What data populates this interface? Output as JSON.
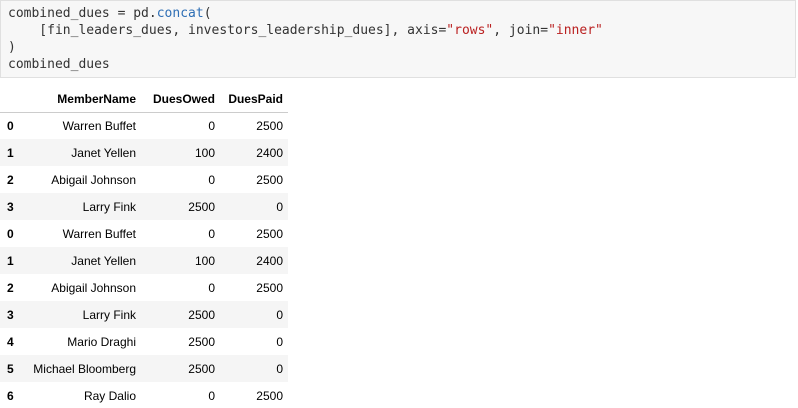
{
  "code_cell": {
    "line1_a": "combined_dues = pd.",
    "line1_fn": "concat",
    "line1_b": "(",
    "line2_a": "    [fin_leaders_dues, investors_leadership_dues], axis=",
    "line2_str1": "\"rows\"",
    "line2_b": ", join=",
    "line2_str2": "\"inner\"",
    "line3": ")",
    "line4": "combined_dues"
  },
  "dataframe": {
    "columns": [
      "",
      "MemberName",
      "DuesOwed",
      "DuesPaid"
    ],
    "rows": [
      {
        "index": "0",
        "MemberName": "Warren Buffet",
        "DuesOwed": "0",
        "DuesPaid": "2500"
      },
      {
        "index": "1",
        "MemberName": "Janet Yellen",
        "DuesOwed": "100",
        "DuesPaid": "2400"
      },
      {
        "index": "2",
        "MemberName": "Abigail Johnson",
        "DuesOwed": "0",
        "DuesPaid": "2500"
      },
      {
        "index": "3",
        "MemberName": "Larry Fink",
        "DuesOwed": "2500",
        "DuesPaid": "0"
      },
      {
        "index": "0",
        "MemberName": "Warren Buffet",
        "DuesOwed": "0",
        "DuesPaid": "2500"
      },
      {
        "index": "1",
        "MemberName": "Janet Yellen",
        "DuesOwed": "100",
        "DuesPaid": "2400"
      },
      {
        "index": "2",
        "MemberName": "Abigail Johnson",
        "DuesOwed": "0",
        "DuesPaid": "2500"
      },
      {
        "index": "3",
        "MemberName": "Larry Fink",
        "DuesOwed": "2500",
        "DuesPaid": "0"
      },
      {
        "index": "4",
        "MemberName": "Mario Draghi",
        "DuesOwed": "2500",
        "DuesPaid": "0"
      },
      {
        "index": "5",
        "MemberName": "Michael Bloomberg",
        "DuesOwed": "2500",
        "DuesPaid": "0"
      },
      {
        "index": "6",
        "MemberName": "Ray Dalio",
        "DuesOwed": "0",
        "DuesPaid": "2500"
      }
    ]
  },
  "colors": {
    "function": "#2f6fb5",
    "string": "#ba2121",
    "cell_background": "#f7f7f7",
    "row_stripe": "#f5f5f5"
  }
}
